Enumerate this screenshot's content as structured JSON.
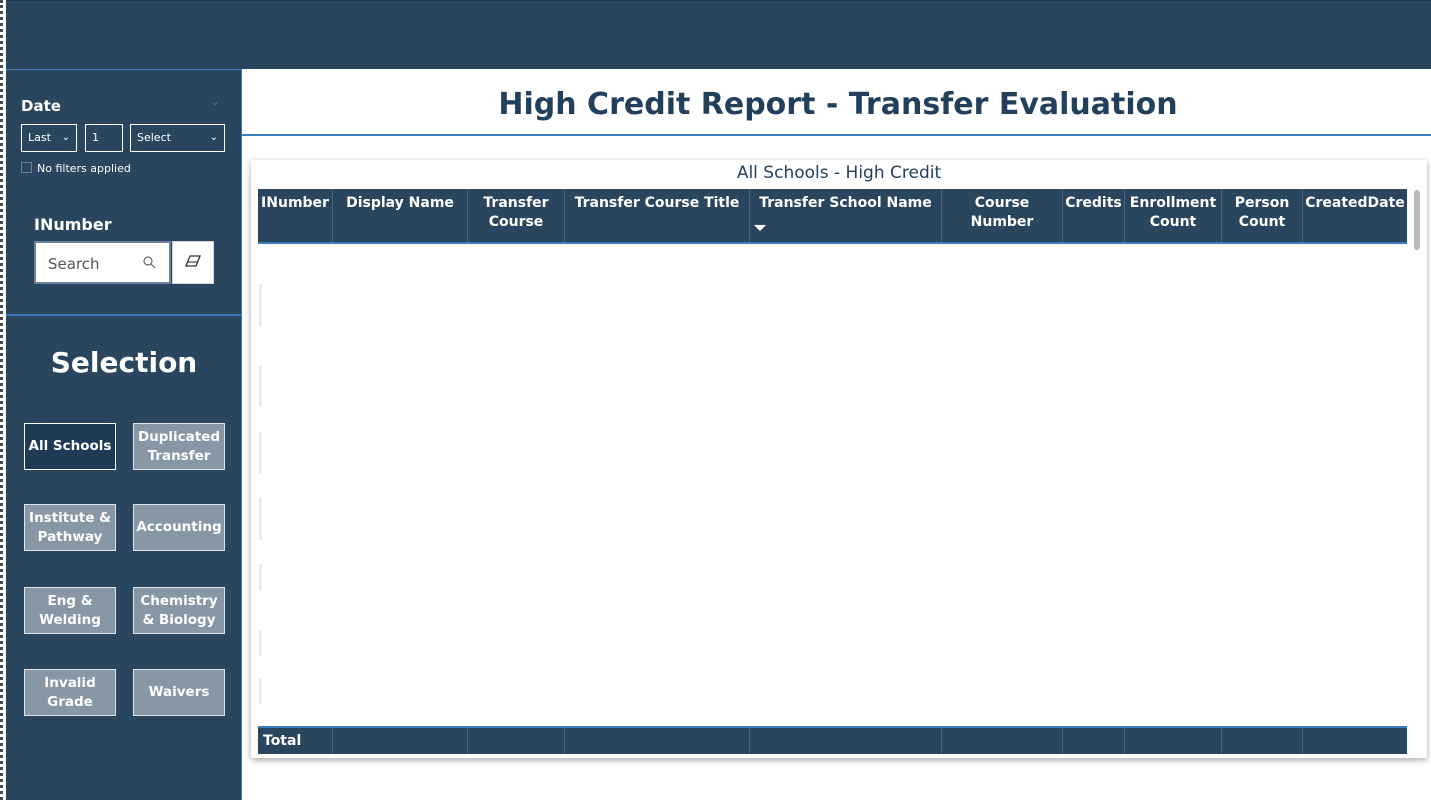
{
  "report": {
    "title": "High Credit Report - Transfer Evaluation"
  },
  "date_filter": {
    "title": "Date",
    "period": "Last",
    "count": "1",
    "unit": "Select",
    "status": "No filters applied"
  },
  "inumber_filter": {
    "title": "INumber",
    "search_placeholder": "Search"
  },
  "selection": {
    "title": "Selection",
    "buttons": [
      {
        "label": "All Schools",
        "active": true
      },
      {
        "label": "Duplicated Transfer",
        "active": false
      },
      {
        "label": "Institute & Pathway",
        "active": false
      },
      {
        "label": "Accounting",
        "active": false
      },
      {
        "label": "Eng & Welding",
        "active": false
      },
      {
        "label": "Chemistry & Biology",
        "active": false
      },
      {
        "label": "Invalid Grade",
        "active": false
      },
      {
        "label": "Waivers",
        "active": false
      }
    ]
  },
  "table": {
    "title": "All Schools - High Credit",
    "columns": [
      "INumber",
      "Display Name",
      "Transfer Course",
      "Transfer Course Title",
      "Transfer School Name",
      "Course Number",
      "Credits",
      "Enrollment Count",
      "Person Count",
      "CreatedDate"
    ],
    "sorted_column": "Transfer School Name",
    "sort_direction": "descending",
    "rows": [],
    "total_label": "Total"
  },
  "colors": {
    "navy": "#2a465e",
    "accent_blue": "#3a7cc0",
    "active_button": "#1e3a56",
    "inactive_button": "#8797a6",
    "title_text": "#22405c"
  }
}
